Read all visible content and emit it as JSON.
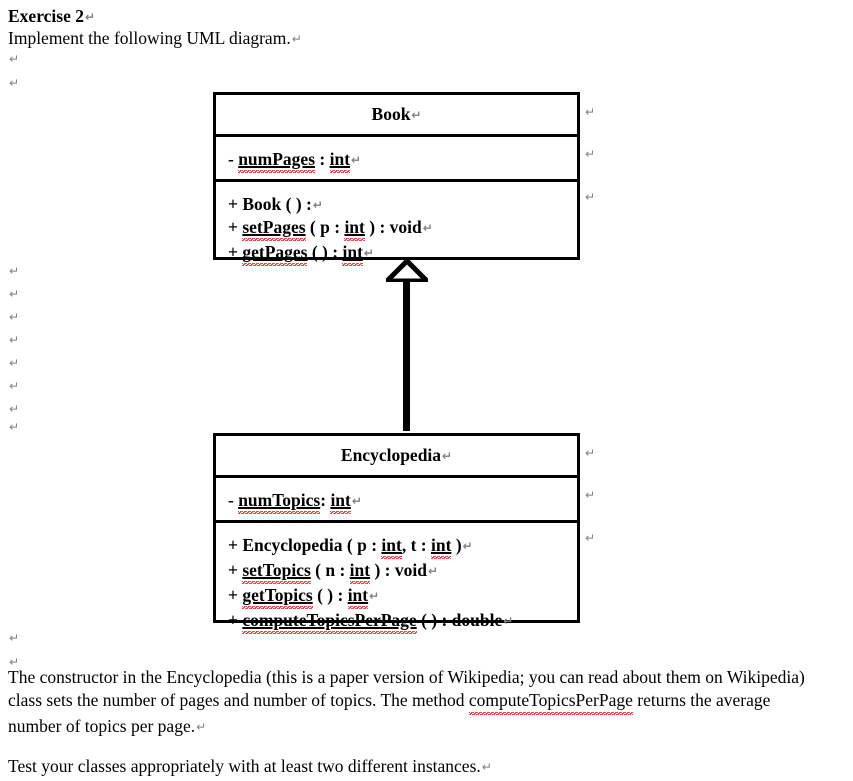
{
  "document": {
    "heading": "Exercise 2",
    "instruction": "Implement the following UML diagram.",
    "pilcrow_glyph": "↵"
  },
  "uml": {
    "arrow": {
      "type": "generalization-arrow",
      "direction": "up",
      "from": "Encyclopedia",
      "to": "Book"
    },
    "classes": [
      {
        "name": "Book",
        "attributes": [
          {
            "visibility": "-",
            "parts": [
              {
                "text": "numPages",
                "underline": true,
                "spellcheck": true
              },
              {
                "text": " : ",
                "underline": false,
                "spellcheck": false
              },
              {
                "text": "int",
                "underline": true,
                "spellcheck": true
              }
            ]
          }
        ],
        "methods": [
          {
            "visibility": "+",
            "parts": [
              {
                "text": "Book ( ) :",
                "underline": false,
                "spellcheck": false
              }
            ]
          },
          {
            "visibility": "+",
            "parts": [
              {
                "text": "setPages",
                "underline": true,
                "spellcheck": true
              },
              {
                "text": " ( p : ",
                "underline": false,
                "spellcheck": false
              },
              {
                "text": "int",
                "underline": true,
                "spellcheck": true
              },
              {
                "text": " ) : void",
                "underline": false,
                "spellcheck": false
              }
            ]
          },
          {
            "visibility": "+",
            "parts": [
              {
                "text": "getPages",
                "underline": true,
                "spellcheck": true
              },
              {
                "text": " ( ) : ",
                "underline": false,
                "spellcheck": false
              },
              {
                "text": "int",
                "underline": true,
                "spellcheck": true
              }
            ]
          }
        ]
      },
      {
        "name": "Encyclopedia",
        "attributes": [
          {
            "visibility": "-",
            "parts": [
              {
                "text": "numTopics",
                "underline": true,
                "spellcheck": true
              },
              {
                "text": ": ",
                "underline": false,
                "spellcheck": false
              },
              {
                "text": "int",
                "underline": true,
                "spellcheck": true
              }
            ]
          }
        ],
        "methods": [
          {
            "visibility": "+",
            "parts": [
              {
                "text": "Encyclopedia ( p : ",
                "underline": false,
                "spellcheck": false
              },
              {
                "text": "int",
                "underline": true,
                "spellcheck": true
              },
              {
                "text": ", t : ",
                "underline": false,
                "spellcheck": false
              },
              {
                "text": "int",
                "underline": true,
                "spellcheck": true
              },
              {
                "text": " )",
                "underline": false,
                "spellcheck": false
              }
            ]
          },
          {
            "visibility": "+",
            "parts": [
              {
                "text": "setTopics",
                "underline": true,
                "spellcheck": true
              },
              {
                "text": " ( n : ",
                "underline": false,
                "spellcheck": false
              },
              {
                "text": "int",
                "underline": true,
                "spellcheck": true
              },
              {
                "text": " ) : void",
                "underline": false,
                "spellcheck": false
              }
            ]
          },
          {
            "visibility": "+",
            "parts": [
              {
                "text": "getTopics",
                "underline": true,
                "spellcheck": true
              },
              {
                "text": " ( ) : ",
                "underline": false,
                "spellcheck": false
              },
              {
                "text": "int",
                "underline": true,
                "spellcheck": true
              }
            ]
          },
          {
            "visibility": "+",
            "parts": [
              {
                "text": "computeTopicsPerPage",
                "underline": true,
                "spellcheck": true
              },
              {
                "text": " ( ) : double",
                "underline": false,
                "spellcheck": false
              }
            ]
          }
        ]
      }
    ]
  },
  "body_text": {
    "paragraph_1_parts": [
      {
        "text": "The constructor in the Encyclopedia (this is a paper version of Wikipedia; you can read about them on Wikipedia) class sets the number of pages and number of topics. The method ",
        "spellcheck": false
      },
      {
        "text": "computeTopicsPerPage",
        "spellcheck": true
      },
      {
        "text": " returns the average number of topics per page.",
        "spellcheck": false
      }
    ],
    "paragraph_2": "Test your classes appropriately with at least two different instances."
  }
}
